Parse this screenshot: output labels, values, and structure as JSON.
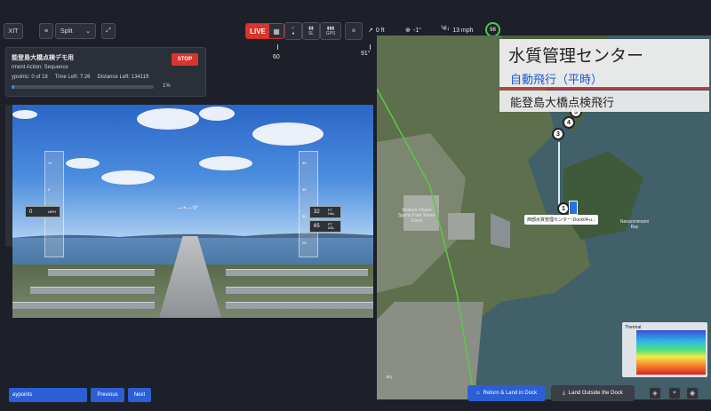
{
  "toolbar": {
    "exit_label": "XIT",
    "layout_label": "Split",
    "live_label": "LIVE",
    "indicators": [
      "SL",
      "GPS"
    ],
    "telemetry": {
      "altitude": "0 ft",
      "heading": "-1°",
      "wind": "13 mph",
      "battery": "98"
    }
  },
  "compass": {
    "ticks": [
      "60",
      "91°",
      "E",
      "120"
    ]
  },
  "mission": {
    "title": "能登島大橋点検デモ用",
    "action": "rment Action: Sequence",
    "waypoints": "ypoints: 0 of 18",
    "time_left": "Time Left: 7:26",
    "distance_left": "Distance Left: 13411ft",
    "progress_label": "1%",
    "progress": 0.01,
    "stop_label": "STOP"
  },
  "video": {
    "speed": "0",
    "speed_unit": "MPH",
    "altitude_hal": "32",
    "altitude_hal_unit": "FT HAL",
    "altitude_asl": "65",
    "altitude_asl_unit": "FT ASL",
    "pitch_marker": "0°",
    "left_scale": [
      "10",
      "5",
      "0"
    ],
    "right_scale": [
      "40",
      "35",
      "30",
      "25"
    ]
  },
  "bottom": {
    "waypoints_label": "aypoints",
    "previous_label": "Previous",
    "next_label": "Next"
  },
  "map": {
    "overlay_title": "水質管理センター",
    "overlay_subtitle": "自動飛行（平時）",
    "overlay_route": "能登島大橋点検飛行",
    "waypoints": [
      "5",
      "4",
      "3",
      "1"
    ],
    "dock_label": "西部水質管理センター-Dock04-u...",
    "bay_label": "Nanaomimami Bay",
    "school_label": "Wakura Onsen Sports Park Tennis Court",
    "ramen_label": "ary",
    "thermal_label": "Thermal",
    "return_btn": "Return & Land in Dock",
    "land_btn": "Land Outside the Dock"
  },
  "colors": {
    "live": "#d9342f",
    "accent": "#3a86ff",
    "route": "#5ac74a"
  }
}
